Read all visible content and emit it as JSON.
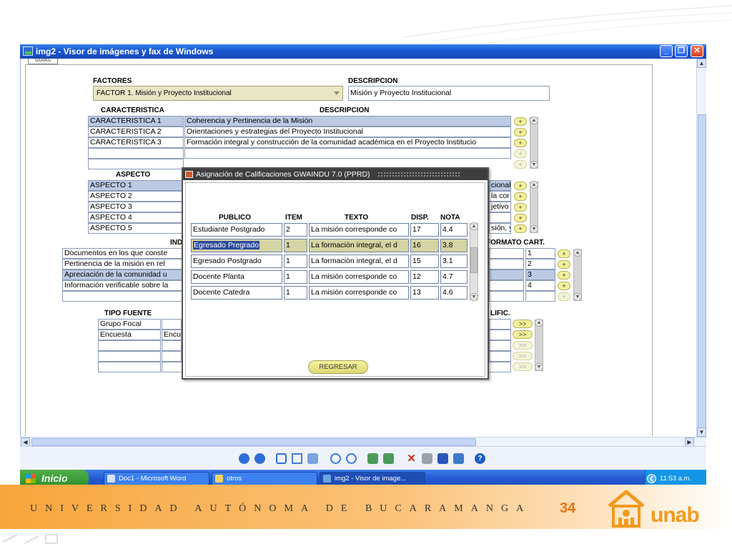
{
  "window": {
    "title": "img2 - Visor de imágenes y fax de Windows",
    "tab_stub": "GUIAS"
  },
  "form": {
    "factores_label": "FACTORES",
    "factor_value": "FACTOR 1. Misión y Proyecto Institucional",
    "descripcion_label": "DESCRIPCION",
    "descripcion_value": "Misión y Proyecto Institucional",
    "caracteristica_label": "CARACTERISTICA",
    "caracteristica_desc_label": "DESCRIPCION",
    "caracteristicas": [
      {
        "name": "CARACTERISTICA 1",
        "desc": "Coherencia y Pertinencia de la Misión"
      },
      {
        "name": "CARACTERISTICA 2",
        "desc": "Orientaciones y estrategias del Proyecto Institucional"
      },
      {
        "name": "CARACTERISTICA 3",
        "desc": "Formación integral y construcción de la comunidad académica en el Proyecto Institucio"
      }
    ],
    "aspecto_label": "ASPECTO",
    "aspectos": [
      {
        "name": "ASPECTO 1",
        "tail": "cional"
      },
      {
        "name": "ASPECTO 2",
        "tail": "la cor"
      },
      {
        "name": "ASPECTO 3",
        "tail": "jetivo"
      },
      {
        "name": "ASPECTO 4",
        "tail": ""
      },
      {
        "name": "ASPECTO 5",
        "tail": "sión, y"
      }
    ],
    "indicador_label_partial": "IND",
    "formato_label": "FORMATO CART.",
    "indicadores": [
      {
        "text": "Documentos en los que conste",
        "cart": "1"
      },
      {
        "text": "Pertinencia de la misión en rel",
        "cart": "2"
      },
      {
        "text": "Apreciación de la comunidad u",
        "cart": "3"
      },
      {
        "text": "Información verificable sobre la",
        "cart": "4"
      }
    ],
    "tipo_fuente_label": "TIPO FUENTE",
    "calific_label_partial": "LIFIC.",
    "fuentes": [
      {
        "col1": "Grupo Focal",
        "col2": ""
      },
      {
        "col1": "Encuesta",
        "col2": "Encu"
      }
    ],
    "plus": "+",
    "next": ">>"
  },
  "dialog": {
    "title": "Asignación de Calificaciones  GWAINDU  7.0  (PPRD)",
    "headers": {
      "publico": "PUBLICO",
      "item": "ITEM",
      "texto": "TEXTO",
      "disp": "DISP.",
      "nota": "NOTA"
    },
    "rows": [
      {
        "publico": "Estudiante Postgrado",
        "item": "2",
        "texto": "La misión corresponde co",
        "disp": "17",
        "nota": "4.4"
      },
      {
        "publico": "Egresado Pregrado",
        "item": "1",
        "texto": "La formaciòn integral, el d",
        "disp": "16",
        "nota": "3.8"
      },
      {
        "publico": "Egresado Postgrado",
        "item": "1",
        "texto": "La formaciòn integral, el d",
        "disp": "15",
        "nota": "3.1"
      },
      {
        "publico": "Docente Planta",
        "item": "1",
        "texto": "La misión corresponde co",
        "disp": "12",
        "nota": "4.7"
      },
      {
        "publico": "Docente Catedra",
        "item": "1",
        "texto": "La misión corresponde co",
        "disp": "13",
        "nota": "4.6"
      }
    ],
    "selected_row": 1,
    "regresar": "REGRESAR"
  },
  "taskbar": {
    "start": "Inicio",
    "tasks": [
      {
        "label": "Doc1 - Microsoft Word",
        "icon": "word-doc-icon"
      },
      {
        "label": "otros",
        "icon": "folder-icon"
      },
      {
        "label": "img2 - Visor de image...",
        "icon": "image-viewer-icon"
      }
    ],
    "clock": "11:53 a.m."
  },
  "footer": {
    "university": "UNIVERSIDAD AUTÓNOMA DE BUCARAMANGA",
    "page_number": "34",
    "logo_text": "unab"
  },
  "colors": {
    "xp_blue": "#1a5bd4",
    "selection": "#bccae4",
    "button_yellow": "#f2f09c",
    "brand_orange": "#f29a1f"
  }
}
